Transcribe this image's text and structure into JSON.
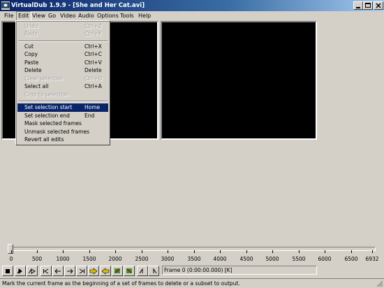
{
  "window": {
    "title": "VirtualDub 1.9.9 - [She and Her Cat.avi]"
  },
  "menubar": [
    {
      "label": "File"
    },
    {
      "label": "Edit"
    },
    {
      "label": "View"
    },
    {
      "label": "Go"
    },
    {
      "label": "Video"
    },
    {
      "label": "Audio"
    },
    {
      "label": "Options"
    },
    {
      "label": "Tools"
    },
    {
      "label": "Help"
    }
  ],
  "edit_menu": {
    "items": [
      {
        "label": "Undo",
        "shortcut": "Ctrl+Z",
        "enabled": false
      },
      {
        "label": "Redo",
        "shortcut": "Ctrl+Y",
        "enabled": false
      },
      {
        "label": "Cut",
        "shortcut": "Ctrl+X",
        "enabled": true
      },
      {
        "label": "Copy",
        "shortcut": "Ctrl+C",
        "enabled": true
      },
      {
        "label": "Paste",
        "shortcut": "Ctrl+V",
        "enabled": true
      },
      {
        "label": "Delete",
        "shortcut": "Delete",
        "enabled": true
      },
      {
        "label": "Clear selection",
        "shortcut": "Ctrl+D",
        "enabled": false
      },
      {
        "label": "Select all",
        "shortcut": "Ctrl+A",
        "enabled": true
      },
      {
        "label": "Crop to selection",
        "shortcut": "",
        "enabled": false
      },
      {
        "label": "Set selection start",
        "shortcut": "Home",
        "enabled": true,
        "highlighted": true
      },
      {
        "label": "Set selection end",
        "shortcut": "End",
        "enabled": true
      },
      {
        "label": "Mask selected frames",
        "shortcut": "",
        "enabled": true
      },
      {
        "label": "Unmask selected frames",
        "shortcut": "",
        "enabled": true
      },
      {
        "label": "Revert all edits",
        "shortcut": "",
        "enabled": true
      }
    ]
  },
  "timeline": {
    "ticks": [
      "0",
      "500",
      "1000",
      "1500",
      "2000",
      "2500",
      "3000",
      "3500",
      "4000",
      "4500",
      "5000",
      "5500",
      "6000",
      "6500",
      "6932"
    ],
    "position_frame": 0
  },
  "frame_display": "Frame 0 (0:00:00.000) [K]",
  "status": "Mark the current frame as the beginning of a set of frames to delete or a subset to output.",
  "colors": {
    "title_bar": "#0a246a",
    "menu_highlight": "#0a246a",
    "face": "#d4d0c8"
  }
}
